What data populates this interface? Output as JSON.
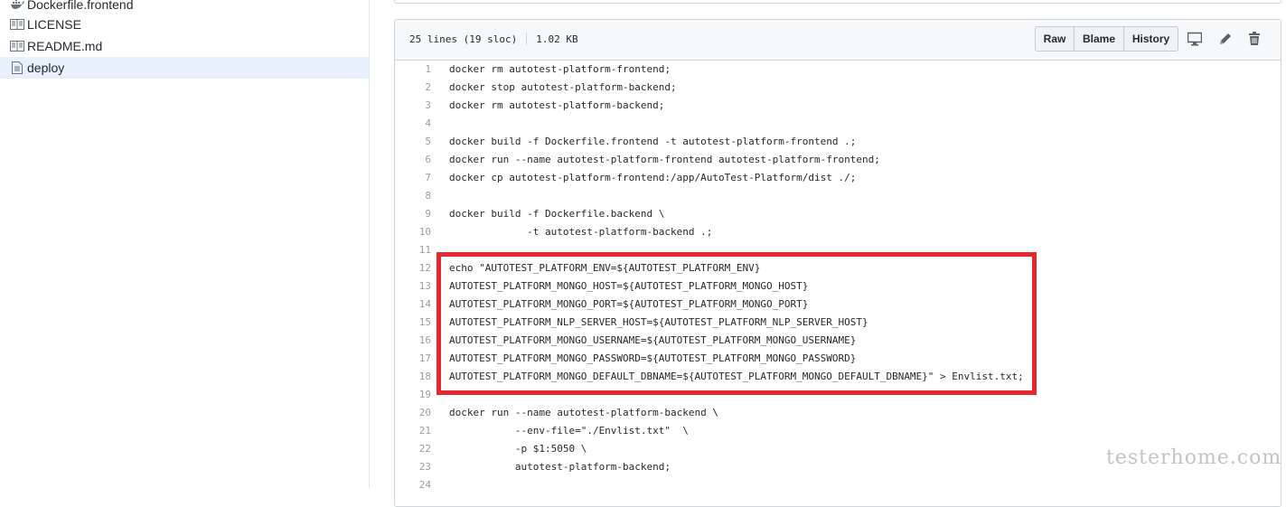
{
  "sidebar": {
    "items": [
      {
        "label": "Dockerfile.frontend",
        "icon": "docker-icon"
      },
      {
        "label": "LICENSE",
        "icon": "book-icon"
      },
      {
        "label": "README.md",
        "icon": "book-icon"
      },
      {
        "label": "deploy",
        "icon": "file-icon",
        "active": true
      }
    ]
  },
  "file": {
    "lines_info": "25 lines (19 sloc)",
    "size": "1.02 KB",
    "buttons": {
      "raw": "Raw",
      "blame": "Blame",
      "history": "History"
    },
    "icons": [
      "desktop-icon",
      "pencil-icon",
      "trash-icon"
    ]
  },
  "code": {
    "lines": [
      {
        "n": "1",
        "text": "docker rm autotest-platform-frontend;"
      },
      {
        "n": "2",
        "text": "docker stop autotest-platform-backend;"
      },
      {
        "n": "3",
        "text": "docker rm autotest-platform-backend;"
      },
      {
        "n": "4",
        "text": ""
      },
      {
        "n": "5",
        "text": "docker build -f Dockerfile.frontend -t autotest-platform-frontend .;"
      },
      {
        "n": "6",
        "text": "docker run --name autotest-platform-frontend autotest-platform-frontend;"
      },
      {
        "n": "7",
        "text": "docker cp autotest-platform-frontend:/app/AutoTest-Platform/dist ./;"
      },
      {
        "n": "8",
        "text": ""
      },
      {
        "n": "9",
        "text": "docker build -f Dockerfile.backend \\"
      },
      {
        "n": "10",
        "text": "             -t autotest-platform-backend .;"
      },
      {
        "n": "11",
        "text": ""
      },
      {
        "n": "12",
        "text": "echo \"AUTOTEST_PLATFORM_ENV=${AUTOTEST_PLATFORM_ENV}"
      },
      {
        "n": "13",
        "text": "AUTOTEST_PLATFORM_MONGO_HOST=${AUTOTEST_PLATFORM_MONGO_HOST}"
      },
      {
        "n": "14",
        "text": "AUTOTEST_PLATFORM_MONGO_PORT=${AUTOTEST_PLATFORM_MONGO_PORT}"
      },
      {
        "n": "15",
        "text": "AUTOTEST_PLATFORM_NLP_SERVER_HOST=${AUTOTEST_PLATFORM_NLP_SERVER_HOST}"
      },
      {
        "n": "16",
        "text": "AUTOTEST_PLATFORM_MONGO_USERNAME=${AUTOTEST_PLATFORM_MONGO_USERNAME}"
      },
      {
        "n": "17",
        "text": "AUTOTEST_PLATFORM_MONGO_PASSWORD=${AUTOTEST_PLATFORM_MONGO_PASSWORD}"
      },
      {
        "n": "18",
        "text": "AUTOTEST_PLATFORM_MONGO_DEFAULT_DBNAME=${AUTOTEST_PLATFORM_MONGO_DEFAULT_DBNAME}\" > Envlist.txt;"
      },
      {
        "n": "19",
        "text": ""
      },
      {
        "n": "20",
        "text": "docker run --name autotest-platform-backend \\"
      },
      {
        "n": "21",
        "text": "           --env-file=\"./Envlist.txt\"  \\"
      },
      {
        "n": "22",
        "text": "           -p $1:5050 \\"
      },
      {
        "n": "23",
        "text": "           autotest-platform-backend;"
      },
      {
        "n": "24",
        "text": ""
      }
    ]
  },
  "annotation": {
    "color": "#e8262d"
  },
  "watermark": "testerhome.com"
}
